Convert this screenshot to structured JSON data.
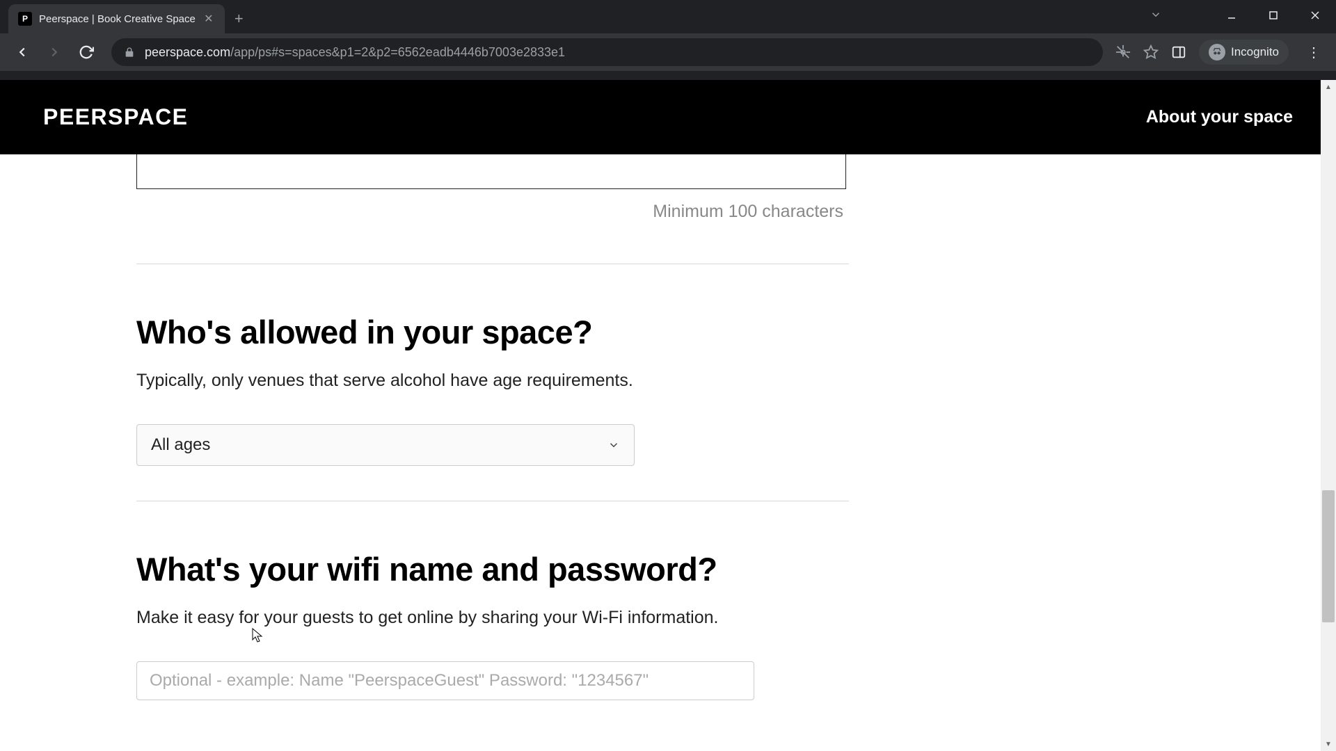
{
  "browser": {
    "tab_title": "Peerspace | Book Creative Space",
    "tab_favicon_letter": "P",
    "url_domain": "peerspace.com",
    "url_path": "/app/ps#s=spaces&p1=2&p2=6562eadb4446b7003e2833e1",
    "incognito_label": "Incognito"
  },
  "header": {
    "logo": "PEERSPACE",
    "right": "About your space"
  },
  "form": {
    "min_chars_helper": "Minimum 100 characters",
    "age_section": {
      "heading": "Who's allowed in your space?",
      "sub": "Typically, only venues that serve alcohol have age requirements.",
      "selected": "All ages"
    },
    "wifi_section": {
      "heading": "What's your wifi name and password?",
      "sub": "Make it easy for your guests to get online by sharing your Wi-Fi information.",
      "placeholder": "Optional - example: Name \"PeerspaceGuest\" Password: \"1234567\""
    }
  }
}
